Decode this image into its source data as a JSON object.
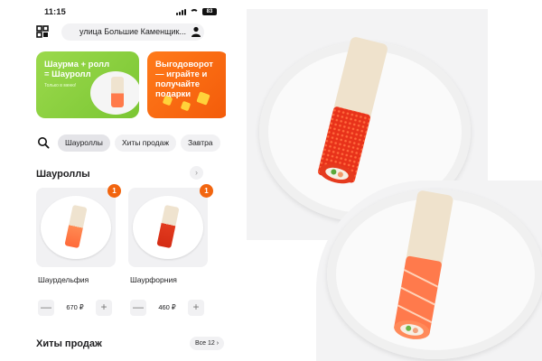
{
  "status_bar": {
    "time": "11:15",
    "battery": "83"
  },
  "header": {
    "address": "улица Большие Каменщик..."
  },
  "promos": [
    {
      "title": "Шаурма + ролл = Шауролл",
      "subtitle": "Только в меню!"
    },
    {
      "title": "Выгодоворот — играйте и получайте подарки"
    }
  ],
  "chips": [
    {
      "label": "Шауроллы",
      "active": true
    },
    {
      "label": "Хиты продаж",
      "active": false
    },
    {
      "label": "Завтра",
      "active": false
    }
  ],
  "section_shaurolls": {
    "title": "Шауроллы"
  },
  "products": [
    {
      "name": "Шаурдельфия",
      "price": "670 ₽",
      "badge": "1",
      "minus": "—",
      "plus": "+"
    },
    {
      "name": "Шаурфорния",
      "price": "460 ₽",
      "badge": "1",
      "minus": "—",
      "plus": "+"
    }
  ],
  "section_hits": {
    "title": "Хиты продаж",
    "all_label": "Все 12"
  },
  "icons": {
    "logo": "logo-icon",
    "user": "user-icon",
    "search": "search-icon",
    "arrow": "chevron-right-icon"
  },
  "colors": {
    "accent": "#f2650f",
    "promo_green": "#8ad13e",
    "promo_orange": "#f86d12"
  }
}
